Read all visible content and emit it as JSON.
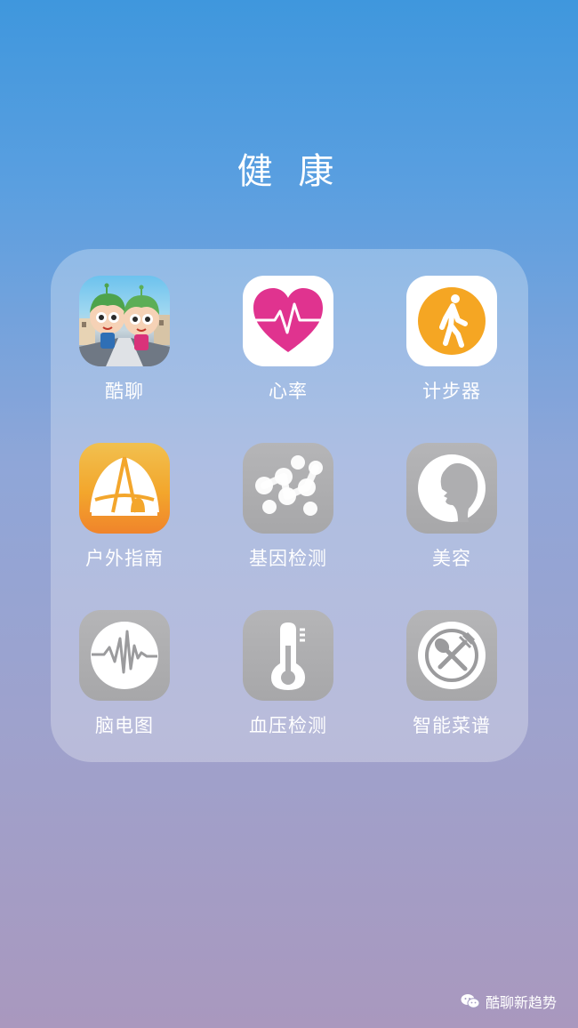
{
  "folder": {
    "title": "健 康"
  },
  "apps": [
    {
      "label": "酷聊",
      "icon": "cartoon-kids-icon"
    },
    {
      "label": "心率",
      "icon": "heart-rate-icon"
    },
    {
      "label": "计步器",
      "icon": "walking-person-icon"
    },
    {
      "label": "户外指南",
      "icon": "tent-icon"
    },
    {
      "label": "基因检测",
      "icon": "molecule-icon"
    },
    {
      "label": "美容",
      "icon": "face-profile-icon"
    },
    {
      "label": "脑电图",
      "icon": "brainwave-icon"
    },
    {
      "label": "血压检测",
      "icon": "thermometer-icon"
    },
    {
      "label": "智能菜谱",
      "icon": "spoon-fork-icon"
    }
  ],
  "watermark": {
    "text": "酷聊新趋势",
    "icon": "wechat-icon"
  },
  "colors": {
    "heart": "#e0338f",
    "walk": "#f5a623",
    "tent": "#f3a62c",
    "gray_icon": "#aeaeb0"
  }
}
